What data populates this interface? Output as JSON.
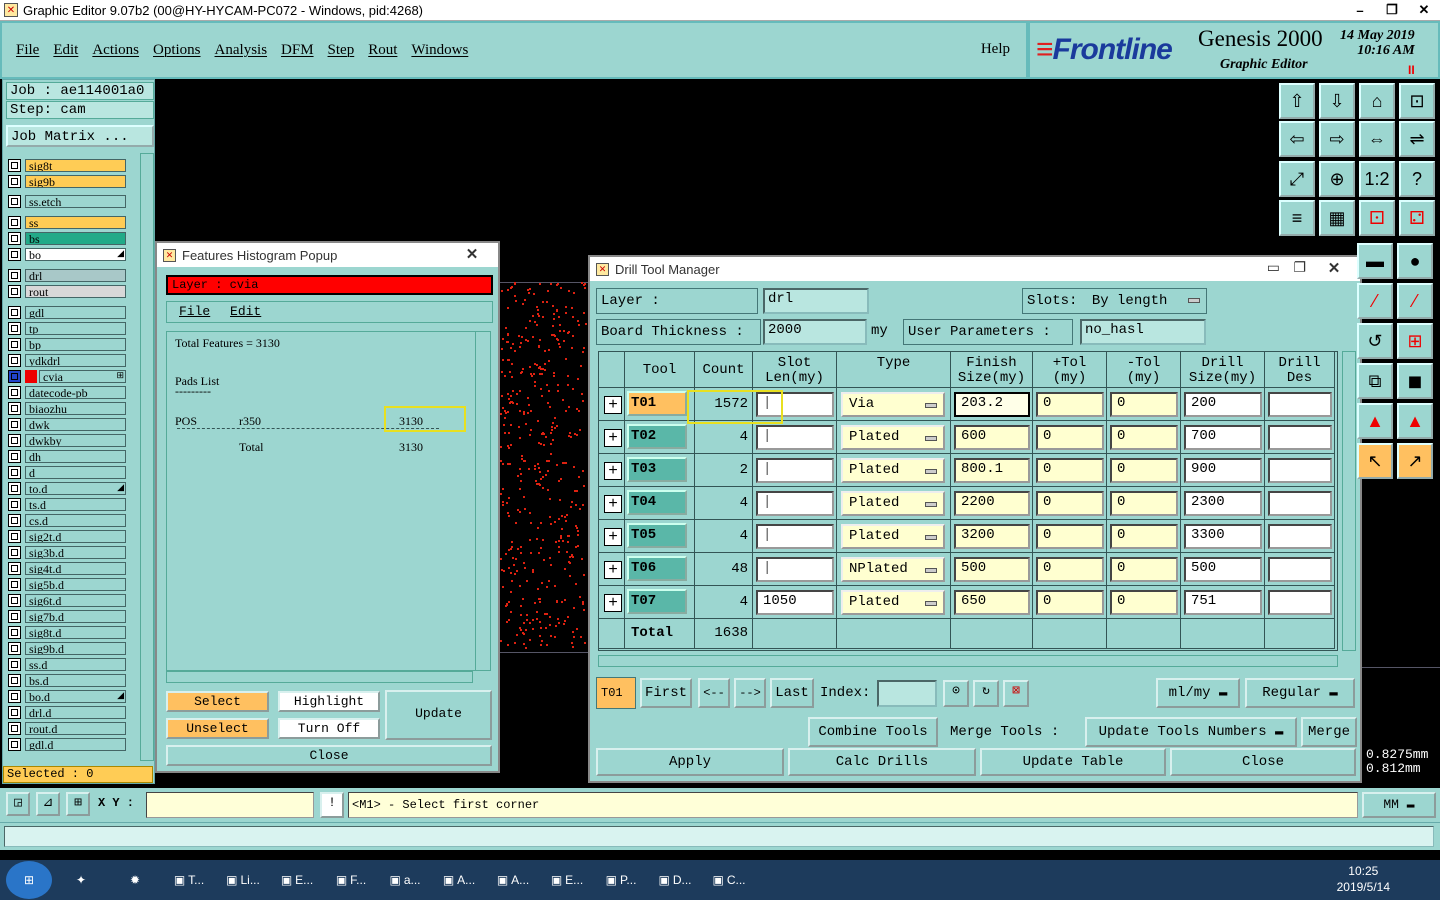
{
  "window": {
    "title": "Graphic Editor 9.07b2 (00@HY-HYCAM-PC072 - Windows, pid:4268)"
  },
  "menu": {
    "items": [
      "File",
      "Edit",
      "Actions",
      "Options",
      "Analysis",
      "DFM",
      "Step",
      "Rout",
      "Windows"
    ],
    "help": "Help"
  },
  "brand": {
    "logo": "Frontline",
    "product": "Genesis 2000",
    "subtitle": "Graphic Editor",
    "date": "14 May 2019",
    "time": "10:16 AM",
    "pause": "II"
  },
  "job": {
    "job": "Job : ae114001a0",
    "step": "Step: cam",
    "matrix": "Job Matrix ..."
  },
  "layers": [
    {
      "name": "sig8t",
      "color": "#ffcc55"
    },
    {
      "name": "sig9b",
      "color": "#ffcc55"
    },
    {
      "name": "ss.etch",
      "color": "#9cd6d0"
    },
    {
      "name": "ss",
      "color": "#ffcc55"
    },
    {
      "name": "bs",
      "color": "#22aa88"
    },
    {
      "name": "bo",
      "color": "#ffffff",
      "mark": "◢"
    },
    {
      "name": "drl",
      "color": "#a8c8c8"
    },
    {
      "name": "rout",
      "color": "#d8d8d8"
    },
    {
      "name": "gdl",
      "color": "#9cd6d0"
    },
    {
      "name": "tp",
      "color": "#9cd6d0"
    },
    {
      "name": "bp",
      "color": "#9cd6d0"
    },
    {
      "name": "ydkdrl",
      "color": "#9cd6d0"
    },
    {
      "name": "cvia",
      "color": "#9cd6d0",
      "active": true,
      "mark": "⊞"
    },
    {
      "name": "datecode-pb",
      "color": "#9cd6d0"
    },
    {
      "name": "biaozhu",
      "color": "#9cd6d0"
    },
    {
      "name": "dwk",
      "color": "#9cd6d0"
    },
    {
      "name": "dwkby",
      "color": "#9cd6d0"
    },
    {
      "name": "dh",
      "color": "#9cd6d0"
    },
    {
      "name": "d",
      "color": "#9cd6d0"
    },
    {
      "name": "to.d",
      "color": "#9cd6d0",
      "mark": "◢"
    },
    {
      "name": "ts.d",
      "color": "#9cd6d0"
    },
    {
      "name": "cs.d",
      "color": "#9cd6d0"
    },
    {
      "name": "sig2t.d",
      "color": "#9cd6d0"
    },
    {
      "name": "sig3b.d",
      "color": "#9cd6d0"
    },
    {
      "name": "sig4t.d",
      "color": "#9cd6d0"
    },
    {
      "name": "sig5b.d",
      "color": "#9cd6d0"
    },
    {
      "name": "sig6t.d",
      "color": "#9cd6d0"
    },
    {
      "name": "sig7b.d",
      "color": "#9cd6d0"
    },
    {
      "name": "sig8t.d",
      "color": "#9cd6d0"
    },
    {
      "name": "sig9b.d",
      "color": "#9cd6d0"
    },
    {
      "name": "ss.d",
      "color": "#9cd6d0"
    },
    {
      "name": "bs.d",
      "color": "#9cd6d0"
    },
    {
      "name": "bo.d",
      "color": "#9cd6d0",
      "mark": "◢"
    },
    {
      "name": "drl.d",
      "color": "#9cd6d0"
    },
    {
      "name": "rout.d",
      "color": "#9cd6d0"
    },
    {
      "name": "gdl.d",
      "color": "#9cd6d0"
    }
  ],
  "selected": "Selected : 0",
  "histogram": {
    "title": "Features Histogram Popup",
    "layer": "Layer : cvia",
    "menu": [
      "File",
      "Edit"
    ],
    "total_features": "Total Features = 3130",
    "pads_list": "Pads List",
    "pads_underline": "---------",
    "row": {
      "pos": "POS",
      "sym": "r350",
      "count": "3130"
    },
    "total_label": "Total",
    "total_value": "3130",
    "buttons": {
      "select": "Select",
      "highlight": "Highlight",
      "unselect": "Unselect",
      "turn_off": "Turn Off",
      "update": "Update",
      "close": "Close"
    }
  },
  "drill": {
    "title": "Drill Tool Manager",
    "layer_label": "Layer        :",
    "layer_value": "drl",
    "slots_label": "Slots:",
    "slots_value": "By length",
    "thickness_label": "Board Thickness :",
    "thickness_value": "2000",
    "thickness_unit": "my",
    "user_params_label": "User Parameters :",
    "user_params_value": "no_hasl",
    "columns": [
      "Tool",
      "Count",
      "Slot Len(my)",
      "Type",
      "Finish Size(my)",
      "+Tol (my)",
      "-Tol (my)",
      "Drill Size(my)",
      "Drill Des"
    ],
    "rows": [
      {
        "tool": "T01",
        "count": "1572",
        "slot": "",
        "type": "Via",
        "finish": "203.2",
        "ptol": "0",
        "mtol": "0",
        "drill": "200",
        "des": ""
      },
      {
        "tool": "T02",
        "count": "4",
        "slot": "",
        "type": "Plated",
        "finish": "600",
        "ptol": "0",
        "mtol": "0",
        "drill": "700",
        "des": ""
      },
      {
        "tool": "T03",
        "count": "2",
        "slot": "",
        "type": "Plated",
        "finish": "800.1",
        "ptol": "0",
        "mtol": "0",
        "drill": "900",
        "des": ""
      },
      {
        "tool": "T04",
        "count": "4",
        "slot": "",
        "type": "Plated",
        "finish": "2200",
        "ptol": "0",
        "mtol": "0",
        "drill": "2300",
        "des": ""
      },
      {
        "tool": "T05",
        "count": "4",
        "slot": "",
        "type": "Plated",
        "finish": "3200",
        "ptol": "0",
        "mtol": "0",
        "drill": "3300",
        "des": ""
      },
      {
        "tool": "T06",
        "count": "48",
        "slot": "",
        "type": "NPlated",
        "finish": "500",
        "ptol": "0",
        "mtol": "0",
        "drill": "500",
        "des": ""
      },
      {
        "tool": "T07",
        "count": "4",
        "slot": "1050",
        "type": "Plated",
        "finish": "650",
        "ptol": "0",
        "mtol": "0",
        "drill": "751",
        "des": ""
      }
    ],
    "total_label": "Total",
    "total_value": "1638",
    "nav": {
      "current": "T01",
      "first": "First",
      "prev": "<--",
      "next": "-->",
      "last": "Last",
      "index": "Index:",
      "units": "ml/my",
      "mode": "Regular"
    },
    "buttons": {
      "combine": "Combine Tools",
      "merge_tools": "Merge Tools :",
      "update_numbers": "Update Tools Numbers",
      "merge": "Merge",
      "apply": "Apply",
      "calc": "Calc Drills",
      "update_table": "Update Table",
      "close": "Close"
    }
  },
  "coords": {
    "x": "0.8275mm",
    "y": "0.812mm"
  },
  "bottom": {
    "xy_label": "X Y :",
    "prompt": "<M1> - Select first corner",
    "units": "MM"
  },
  "taskbar": {
    "apps": [
      "T...",
      "Li...",
      "E...",
      "F...",
      "a...",
      "A...",
      "A...",
      "E...",
      "P...",
      "D...",
      "C..."
    ],
    "time": "10:25",
    "date": "2019/5/14"
  }
}
